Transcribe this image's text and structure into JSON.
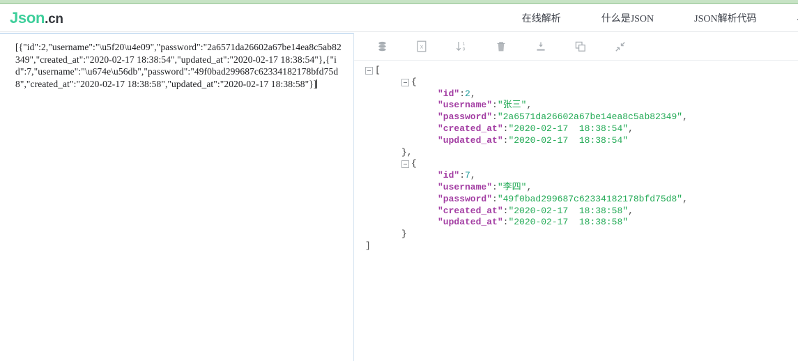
{
  "site": {
    "logo_main": "Json",
    "logo_tld": ".cn",
    "top_strip_color": "#c7e3c5",
    "brand_color": "#3ecf9b"
  },
  "nav": {
    "items": [
      {
        "label": "在线解析",
        "name": "nav-online-parse"
      },
      {
        "label": "什么是JSON",
        "name": "nav-what-is-json"
      },
      {
        "label": "JSON解析代码",
        "name": "nav-json-parse-code"
      },
      {
        "label": "JSO",
        "name": "nav-json-truncated"
      }
    ]
  },
  "editor": {
    "raw_json": "[{\"id\":2,\"username\":\"\\u5f20\\u4e09\",\"password\":\"2a6571da26602a67be14ea8c5ab82349\",\"created_at\":\"2020-02-17 18:38:54\",\"updated_at\":\"2020-02-17 18:38:54\"},{\"id\":7,\"username\":\"\\u674e\\u56db\",\"password\":\"49f0bad299687c62334182178bfd75d8\",\"created_at\":\"2020-02-17 18:38:58\",\"updated_at\":\"2020-02-17 18:38:58\"}]",
    "placeholder": ""
  },
  "toolbar": {
    "buttons": [
      {
        "name": "database-icon",
        "title": "数据库"
      },
      {
        "name": "xml-file-icon",
        "title": "XML"
      },
      {
        "name": "sort-icon",
        "title": "排序"
      },
      {
        "name": "trash-icon",
        "title": "清空"
      },
      {
        "name": "download-icon",
        "title": "下载"
      },
      {
        "name": "copy-icon",
        "title": "复制"
      },
      {
        "name": "collapse-icon",
        "title": "折叠"
      }
    ]
  },
  "viewer": {
    "colors": {
      "key": "#a33ea3",
      "string": "#22aa55",
      "number": "#1f9b9b",
      "punctuation": "#4a4a4a"
    },
    "lines": [
      {
        "fold": true,
        "indent": 0,
        "tokens": [
          {
            "t": "punc",
            "v": "["
          }
        ]
      },
      {
        "fold": true,
        "indent": 1,
        "tokens": [
          {
            "t": "punc",
            "v": "{"
          }
        ]
      },
      {
        "fold": false,
        "indent": 2,
        "tokens": [
          {
            "t": "key",
            "v": "\"id\""
          },
          {
            "t": "punc",
            "v": ":"
          },
          {
            "t": "num",
            "v": "2"
          },
          {
            "t": "punc",
            "v": ","
          }
        ]
      },
      {
        "fold": false,
        "indent": 2,
        "tokens": [
          {
            "t": "key",
            "v": "\"username\""
          },
          {
            "t": "punc",
            "v": ":"
          },
          {
            "t": "str",
            "v": "\"张三\""
          },
          {
            "t": "punc",
            "v": ","
          }
        ]
      },
      {
        "fold": false,
        "indent": 2,
        "tokens": [
          {
            "t": "key",
            "v": "\"password\""
          },
          {
            "t": "punc",
            "v": ":"
          },
          {
            "t": "str",
            "v": "\"2a6571da26602a67be14ea8c5ab82349\""
          },
          {
            "t": "punc",
            "v": ","
          }
        ]
      },
      {
        "fold": false,
        "indent": 2,
        "tokens": [
          {
            "t": "key",
            "v": "\"created_at\""
          },
          {
            "t": "punc",
            "v": ":"
          },
          {
            "t": "str",
            "v": "\"2020-02-17  18:38:54\""
          },
          {
            "t": "punc",
            "v": ","
          }
        ]
      },
      {
        "fold": false,
        "indent": 2,
        "tokens": [
          {
            "t": "key",
            "v": "\"updated_at\""
          },
          {
            "t": "punc",
            "v": ":"
          },
          {
            "t": "str",
            "v": "\"2020-02-17  18:38:54\""
          }
        ]
      },
      {
        "fold": false,
        "indent": 1,
        "tokens": [
          {
            "t": "punc",
            "v": "},"
          }
        ]
      },
      {
        "fold": true,
        "indent": 1,
        "tokens": [
          {
            "t": "punc",
            "v": "{"
          }
        ]
      },
      {
        "fold": false,
        "indent": 2,
        "tokens": [
          {
            "t": "key",
            "v": "\"id\""
          },
          {
            "t": "punc",
            "v": ":"
          },
          {
            "t": "num",
            "v": "7"
          },
          {
            "t": "punc",
            "v": ","
          }
        ]
      },
      {
        "fold": false,
        "indent": 2,
        "tokens": [
          {
            "t": "key",
            "v": "\"username\""
          },
          {
            "t": "punc",
            "v": ":"
          },
          {
            "t": "str",
            "v": "\"李四\""
          },
          {
            "t": "punc",
            "v": ","
          }
        ]
      },
      {
        "fold": false,
        "indent": 2,
        "tokens": [
          {
            "t": "key",
            "v": "\"password\""
          },
          {
            "t": "punc",
            "v": ":"
          },
          {
            "t": "str",
            "v": "\"49f0bad299687c62334182178bfd75d8\""
          },
          {
            "t": "punc",
            "v": ","
          }
        ]
      },
      {
        "fold": false,
        "indent": 2,
        "tokens": [
          {
            "t": "key",
            "v": "\"created_at\""
          },
          {
            "t": "punc",
            "v": ":"
          },
          {
            "t": "str",
            "v": "\"2020-02-17  18:38:58\""
          },
          {
            "t": "punc",
            "v": ","
          }
        ]
      },
      {
        "fold": false,
        "indent": 2,
        "tokens": [
          {
            "t": "key",
            "v": "\"updated_at\""
          },
          {
            "t": "punc",
            "v": ":"
          },
          {
            "t": "str",
            "v": "\"2020-02-17  18:38:58\""
          }
        ]
      },
      {
        "fold": false,
        "indent": 1,
        "tokens": [
          {
            "t": "punc",
            "v": "}"
          }
        ]
      },
      {
        "fold": false,
        "indent": 0,
        "tokens": [
          {
            "t": "punc",
            "v": "]"
          }
        ]
      }
    ]
  }
}
